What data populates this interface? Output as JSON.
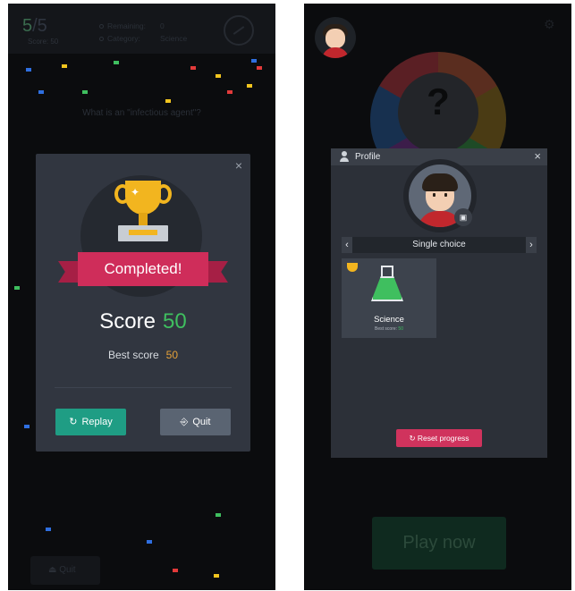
{
  "left": {
    "header": {
      "score_current": "5",
      "score_total": "/5",
      "score_label": "Score: 50",
      "remaining_label": "Remaining:",
      "remaining_value": "0",
      "category_label": "Category:",
      "category_value": "Science"
    },
    "question": "What is an \"infectious agent\"?",
    "bg_quit_label": "Quit",
    "modal": {
      "banner": "Completed!",
      "score_label": "Score",
      "score_value": "50",
      "best_label": "Best score",
      "best_value": "50",
      "replay_label": "Replay",
      "quit_label": "Quit",
      "close": "×"
    },
    "colors": {
      "replay": "#1f9d84",
      "banner": "#cf2d5a",
      "score": "#3fbf5f",
      "best": "#e5a139"
    }
  },
  "right": {
    "wheel_glyph": "?",
    "play_now_label": "Play now",
    "profile": {
      "title": "Profile",
      "close": "×",
      "mode_label": "Single choice",
      "prev": "‹",
      "next": "›",
      "category": {
        "name": "Science",
        "best_label": "Best score:",
        "best_value": "50"
      },
      "reset_label": "Reset progress"
    },
    "colors": {
      "reset": "#d0335d",
      "flask": "#3fbf5f"
    }
  }
}
